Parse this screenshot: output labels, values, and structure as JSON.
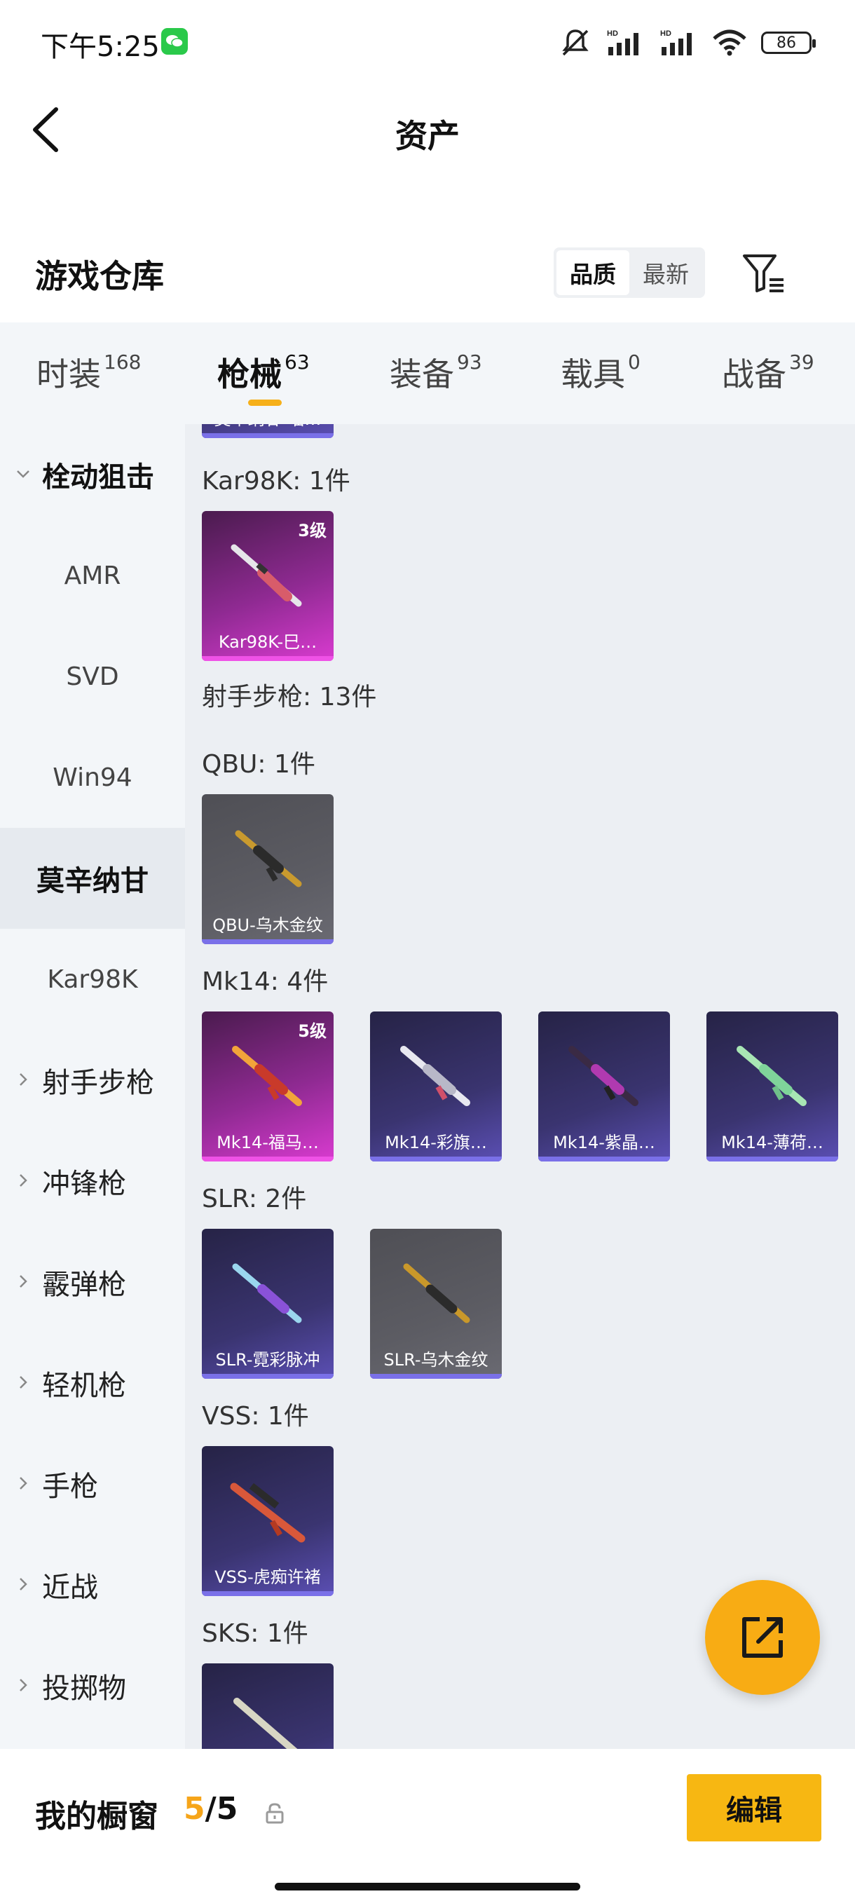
{
  "status_bar": {
    "time": "下午5:25",
    "battery": "86"
  },
  "header": {
    "title": "资产",
    "back_icon": "back-arrow-icon"
  },
  "warehouse": {
    "title": "游戏仓库",
    "sort_options": [
      "品质",
      "最新"
    ],
    "active_sort": "品质",
    "filter_icon": "filter-icon"
  },
  "tabs": [
    {
      "label": "时装",
      "count": "168"
    },
    {
      "label": "枪械",
      "count": "63"
    },
    {
      "label": "装备",
      "count": "93"
    },
    {
      "label": "载具",
      "count": "0"
    },
    {
      "label": "战备",
      "count": "39"
    }
  ],
  "active_tab": "枪械",
  "sidebar": {
    "items": [
      {
        "label": "栓动狙击",
        "type": "parent",
        "expanded": true
      },
      {
        "label": "AMR",
        "type": "sub"
      },
      {
        "label": "SVD",
        "type": "sub"
      },
      {
        "label": "Win94",
        "type": "sub"
      },
      {
        "label": "莫辛纳甘",
        "type": "sub",
        "selected": true
      },
      {
        "label": "Kar98K",
        "type": "sub"
      },
      {
        "label": "射手步枪",
        "type": "parent"
      },
      {
        "label": "冲锋枪",
        "type": "parent"
      },
      {
        "label": "霰弹枪",
        "type": "parent"
      },
      {
        "label": "轻机枪",
        "type": "parent"
      },
      {
        "label": "手枪",
        "type": "parent"
      },
      {
        "label": "近战",
        "type": "parent"
      },
      {
        "label": "投掷物",
        "type": "parent"
      }
    ]
  },
  "content": {
    "groups": [
      {
        "label": "Kar98K: 1件",
        "items": [
          {
            "name": "Kar98K-巳…",
            "grade": "3级",
            "rarity": "pink"
          }
        ]
      },
      {
        "label": "射手步枪: 13件",
        "items": []
      },
      {
        "label": "QBU: 1件",
        "items": [
          {
            "name": "QBU-乌木金纹",
            "grade": "",
            "rarity": "gray"
          }
        ]
      },
      {
        "label": "Mk14: 4件",
        "items": [
          {
            "name": "Mk14-福马…",
            "grade": "5级",
            "rarity": "pink"
          },
          {
            "name": "Mk14-彩旗…",
            "grade": "",
            "rarity": "purple"
          },
          {
            "name": "Mk14-紫晶…",
            "grade": "",
            "rarity": "purple"
          },
          {
            "name": "Mk14-薄荷…",
            "grade": "",
            "rarity": "purple"
          }
        ]
      },
      {
        "label": "SLR: 2件",
        "items": [
          {
            "name": "SLR-霓彩脉冲",
            "grade": "",
            "rarity": "purple"
          },
          {
            "name": "SLR-乌木金纹",
            "grade": "",
            "rarity": "gray"
          }
        ]
      },
      {
        "label": "VSS: 1件",
        "items": [
          {
            "name": "VSS-虎痴许褚",
            "grade": "",
            "rarity": "purple"
          }
        ]
      },
      {
        "label": "SKS: 1件",
        "items": [
          {
            "name": "",
            "grade": "",
            "rarity": "purple"
          }
        ]
      }
    ],
    "top_partial_card_name": "莫辛纳甘-喵…"
  },
  "fab": {
    "icon": "share-export-icon"
  },
  "showcase": {
    "label": "我的橱窗",
    "current": "5",
    "total": "5",
    "lock_icon": "lock-icon"
  },
  "edit_button": {
    "label": "编辑"
  },
  "colors": {
    "accent": "#f6b01a",
    "pink_card": "#8f2a92",
    "purple_card": "#3a3470",
    "gray_card": "#5c5c63"
  }
}
